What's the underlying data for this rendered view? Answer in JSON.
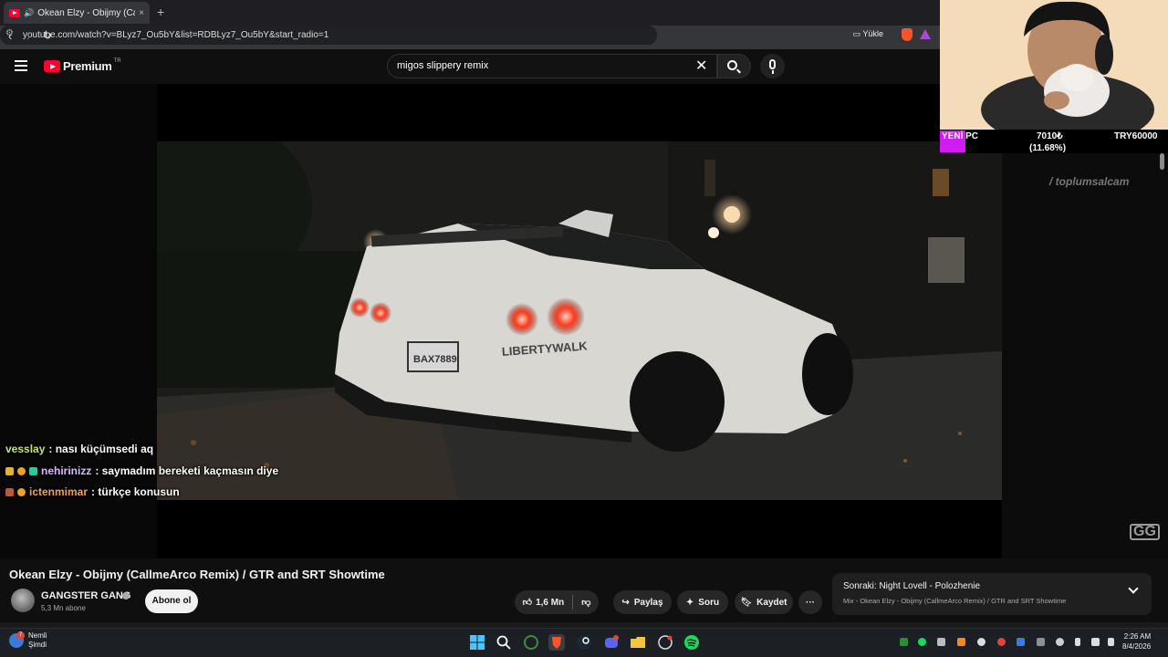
{
  "browser": {
    "tab_title": "Okean Elzy - Obijmy (CallmeArco Remix)",
    "tab_close": "×",
    "new_tab": "+",
    "url": "youtube.com/watch?v=BLyz7_Ou5bY&list=RDBLyz7_Ou5bY&start_radio=1",
    "install_label": "Yükle"
  },
  "youtube": {
    "logo_text": "Premium",
    "region": "TR",
    "search_value": "migos slippery remix"
  },
  "stream_overlay": {
    "stats_label": "YENİ PC",
    "stats_amount": "7010₺",
    "stats_percent": "(11.68%)",
    "stats_goal": "TRY60000",
    "watermark": "/ toplumsalcam",
    "chat": [
      {
        "user": "vesslay",
        "message": ": nası küçümsedi aq",
        "user_color": "#c6e36b"
      },
      {
        "user": "nehirinizz",
        "message": ": saymadım bereketi kaçmasın diye",
        "user_color": "#d9b8ff"
      },
      {
        "user": "ictenmimar",
        "message": ": türkçe konusun",
        "user_color": "#f0a24a"
      }
    ],
    "corner_logo": "GG"
  },
  "video": {
    "title": "Okean Elzy - Obijmy (CallmeArco Remix) / GTR and SRT Showtime",
    "channel": "GANGSTER GANG",
    "subscribers": "5,3 Mn abone",
    "subscribe_label": "Abone ol",
    "likes": "1,6 Mn",
    "share_label": "Paylaş",
    "ask_label": "Soru",
    "save_label": "Kaydet",
    "more_label": "···"
  },
  "up_next": {
    "title": "Sonraki: Night Lovell - Polozhenie",
    "subtitle": "Mix - Okean Elzy - Obijmy (CallmeArco Remix) / GTR and SRT Showtime"
  },
  "taskbar": {
    "weather_line1": "Nemli",
    "weather_line2": "Şimdi",
    "notification_count": "7",
    "time": "2:26 AM",
    "date": "8/4/2026"
  },
  "colors": {
    "youtube_red": "#ff0033",
    "overlay_magenta": "#d01cf0"
  }
}
